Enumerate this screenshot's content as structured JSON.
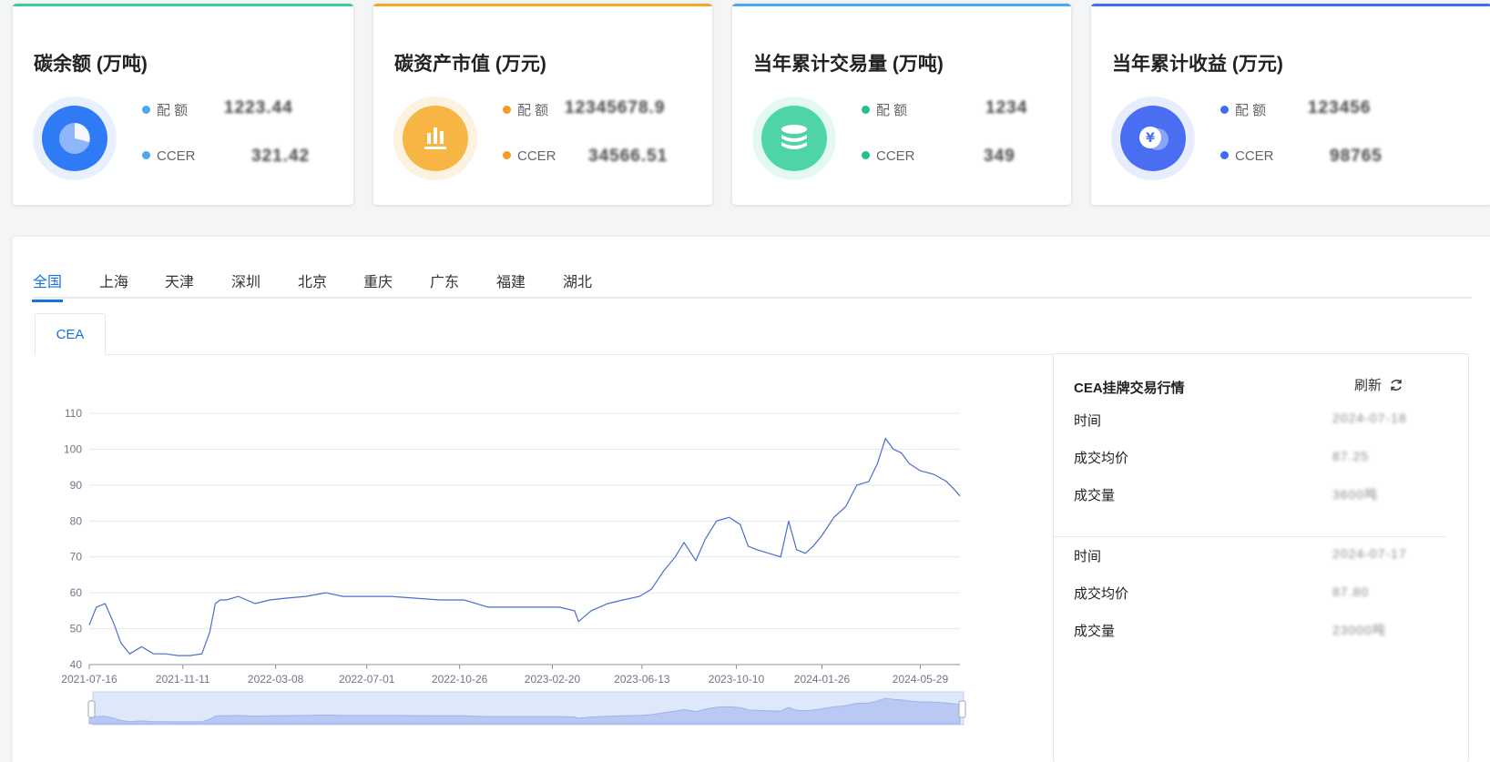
{
  "cards": [
    {
      "title": "碳余额 (万吨)",
      "accent": "#3ccb9a",
      "icon": "pie-chart-icon",
      "icon_color": "#2f7bf5",
      "ring_color": "#e8f0fe",
      "rows": [
        {
          "label": "配 额",
          "value": "1223.44",
          "dot": "#4aa8f0"
        },
        {
          "label": "CCER",
          "value": "321.42",
          "dot": "#4aa8f0"
        }
      ]
    },
    {
      "title": "碳资产市值 (万元)",
      "accent": "#f5a623",
      "icon": "bar-chart-icon",
      "icon_color": "#f7b543",
      "ring_color": "#fdf2e0",
      "rows": [
        {
          "label": "配 额",
          "value": "12345678.9",
          "dot": "#f59a23"
        },
        {
          "label": "CCER",
          "value": "34566.51",
          "dot": "#f59a23"
        }
      ]
    },
    {
      "title": "当年累计交易量 (万吨)",
      "accent": "#4aa8f0",
      "icon": "coin-stack-icon",
      "icon_color": "#4fd4a8",
      "ring_color": "#e4f8f1",
      "rows": [
        {
          "label": "配 额",
          "value": "1234",
          "dot": "#22c08a"
        },
        {
          "label": "CCER",
          "value": "349",
          "dot": "#22c08a"
        }
      ]
    },
    {
      "title": "当年累计收益 (万元)",
      "accent": "#3a6ff0",
      "icon": "yuan-coin-icon",
      "icon_color": "#4a6ef2",
      "ring_color": "#e8edfd",
      "rows": [
        {
          "label": "配 额",
          "value": "123456",
          "dot": "#3a6ff0"
        },
        {
          "label": "CCER",
          "value": "98765",
          "dot": "#3a6ff0"
        }
      ]
    }
  ],
  "tabs": [
    "全国",
    "上海",
    "天津",
    "深圳",
    "北京",
    "重庆",
    "广东",
    "福建",
    "湖北"
  ],
  "active_tab": "全国",
  "subtab": "CEA",
  "info": {
    "title": "CEA挂牌交易行情",
    "refresh": "刷新",
    "block1": {
      "time_label": "时间",
      "time": "2024-07-18",
      "price_label": "成交均价",
      "price": "87.25",
      "volume_label": "成交量",
      "volume": "3600吨"
    },
    "block2": {
      "time_label": "时间",
      "time": "2024-07-17",
      "price_label": "成交均价",
      "price": "87.80",
      "volume_label": "成交量",
      "volume": "23000吨"
    }
  },
  "chart_data": {
    "type": "line",
    "x_ticks": [
      "2021-07-16",
      "2021-11-11",
      "2022-03-08",
      "2022-07-01",
      "2022-10-26",
      "2023-02-20",
      "2023-06-13",
      "2023-10-10",
      "2024-01-26",
      "2024-05-29"
    ],
    "y_ticks": [
      40,
      50,
      60,
      70,
      80,
      90,
      100,
      110
    ],
    "ylim": [
      40,
      110
    ],
    "xlim": [
      "2021-07-16",
      "2024-07-18"
    ],
    "grid": true,
    "line_color": "#4a6ec9",
    "series": [
      {
        "x": [
          "2021-07-16",
          "2021-07-25",
          "2021-08-05",
          "2021-08-15",
          "2021-08-25",
          "2021-09-05",
          "2021-09-20",
          "2021-10-05",
          "2021-10-20",
          "2021-11-05",
          "2021-11-20",
          "2021-12-05",
          "2021-12-15",
          "2021-12-22",
          "2021-12-28",
          "2022-01-05",
          "2022-01-20",
          "2022-02-10",
          "2022-03-01",
          "2022-03-20",
          "2022-04-15",
          "2022-05-10",
          "2022-06-01",
          "2022-07-01",
          "2022-08-01",
          "2022-09-01",
          "2022-10-01",
          "2022-11-01",
          "2022-12-01",
          "2023-01-01",
          "2023-01-20",
          "2023-02-10",
          "2023-03-01",
          "2023-03-20",
          "2023-03-25",
          "2023-04-10",
          "2023-05-01",
          "2023-05-20",
          "2023-06-10",
          "2023-06-25",
          "2023-07-10",
          "2023-07-25",
          "2023-08-05",
          "2023-08-20",
          "2023-09-01",
          "2023-09-15",
          "2023-10-01",
          "2023-10-15",
          "2023-10-25",
          "2023-11-05",
          "2023-11-20",
          "2023-12-05",
          "2023-12-15",
          "2023-12-25",
          "2024-01-05",
          "2024-01-15",
          "2024-01-26",
          "2024-02-10",
          "2024-02-25",
          "2024-03-10",
          "2024-03-25",
          "2024-04-05",
          "2024-04-15",
          "2024-04-25",
          "2024-05-05",
          "2024-05-15",
          "2024-05-29",
          "2024-06-15",
          "2024-07-01",
          "2024-07-10",
          "2024-07-18"
        ],
        "values": [
          51,
          56,
          57,
          52,
          46,
          43,
          45,
          43,
          43,
          42.5,
          42.5,
          43,
          49,
          57,
          58,
          58,
          59,
          57,
          58,
          58.5,
          59,
          60,
          59,
          59,
          59,
          58.5,
          58,
          58,
          56,
          56,
          56,
          56,
          56,
          55,
          52,
          55,
          57,
          58,
          59,
          61,
          66,
          70,
          74,
          69,
          75,
          80,
          81,
          79,
          73,
          72,
          71,
          70,
          80,
          72,
          71,
          73,
          76,
          81,
          84,
          90,
          91,
          96,
          103,
          100,
          99,
          96,
          94,
          93,
          91,
          89,
          87
        ]
      }
    ]
  }
}
